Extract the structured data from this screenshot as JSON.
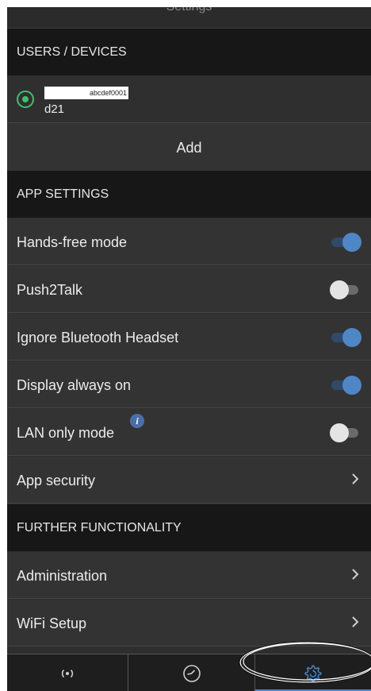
{
  "title": "Settings",
  "sections": {
    "users_devices": "USERS / DEVICES",
    "app_settings": "APP SETTINGS",
    "further_functionality": "FURTHER FUNCTIONALITY"
  },
  "device": {
    "id": "abcdef0001",
    "name": "d21",
    "selected": true
  },
  "add_label": "Add",
  "settings": [
    {
      "label": "Hands-free mode",
      "enabled": true
    },
    {
      "label": "Push2Talk",
      "enabled": false
    },
    {
      "label": "Ignore Bluetooth Headset",
      "enabled": true
    },
    {
      "label": "Display always on",
      "enabled": true
    },
    {
      "label": "LAN only mode",
      "enabled": false,
      "info_icon": "info-icon"
    },
    {
      "label": "App security",
      "icon": "chevron-right-icon"
    }
  ],
  "further": [
    {
      "label": "Administration",
      "icon": "chevron-right-icon"
    },
    {
      "label": "WiFi Setup",
      "icon": "chevron-right-icon"
    }
  ],
  "nav": [
    {
      "icon": "radio-waves-icon"
    },
    {
      "icon": "speedometer-icon"
    },
    {
      "icon": "gear-icon",
      "active": true
    }
  ],
  "colors": {
    "accent": "#4f86c6",
    "radio": "#3fbf6a",
    "background": "#2e2e2e",
    "section_header": "#171717"
  }
}
